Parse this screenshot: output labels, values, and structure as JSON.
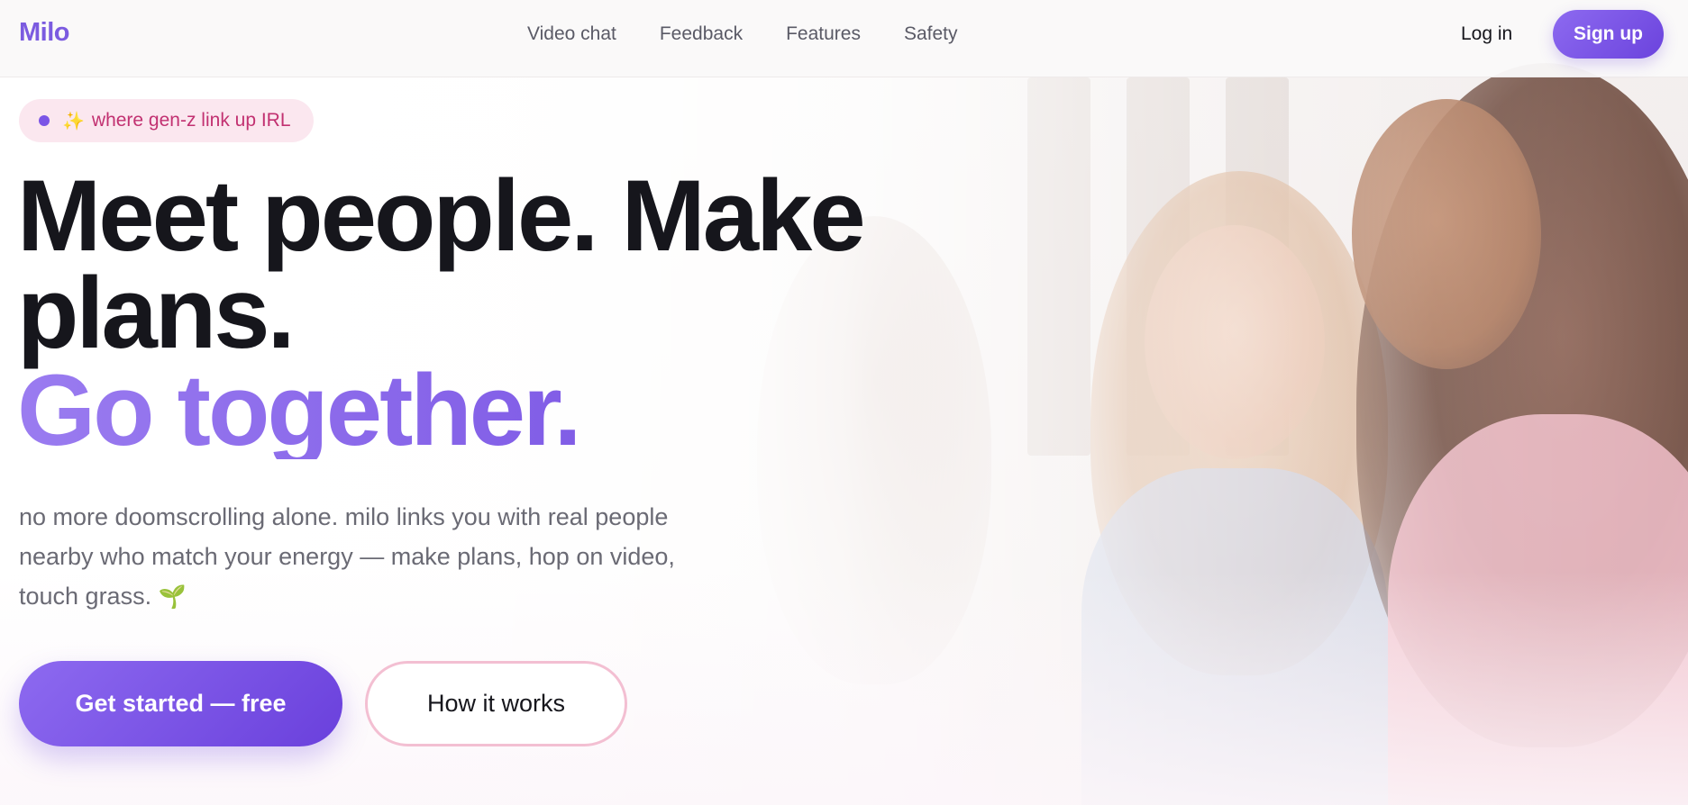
{
  "nav": {
    "logo": "Milo",
    "links": [
      {
        "label": "Video chat"
      },
      {
        "label": "Feedback"
      },
      {
        "label": "Features"
      },
      {
        "label": "Safety"
      }
    ],
    "login_label": "Log in",
    "signup_label": "Sign up"
  },
  "hero": {
    "tagline_icon": "sparkles",
    "tagline": "where gen-z link up IRL",
    "headline_line1": "Meet people. Make",
    "headline_line2": "plans.",
    "headline_accent": "Go together.",
    "subtext": "no more doomscrolling alone. milo links you with real people nearby who match your energy — make plans, hop on video, touch grass.",
    "subtext_icon": "seedling",
    "cta_primary": "Get started — free",
    "cta_secondary": "How it works"
  },
  "colors": {
    "brand": "#7b5be0",
    "pill_background": "#fbe7ef",
    "pill_text": "#c23171",
    "heading": "#16161c",
    "body_text": "#6a6a74"
  }
}
